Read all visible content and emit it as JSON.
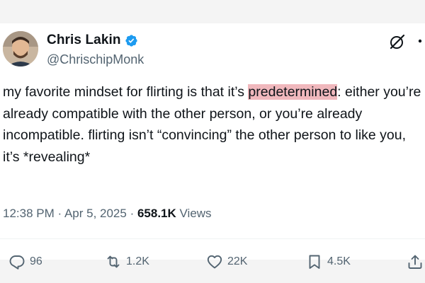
{
  "author": {
    "name": "Chris Lakin",
    "handle": "@ChrischipMonk"
  },
  "tweet": {
    "text_before": "my favorite mindset for flirting is that it’s ",
    "highlight": "predetermined",
    "text_after": ": either you’re already compatible with the other person, or you’re already incompatible. flirting isn’t “convincing” the other person to like you, it’s *revealing*"
  },
  "meta": {
    "time": "12:38 PM",
    "sep1": " · ",
    "date": "Apr 5, 2025",
    "sep2": " · ",
    "views_count": "658.1K",
    "views_label": " Views"
  },
  "stats": {
    "replies": "96",
    "reposts": "1.2K",
    "likes": "22K",
    "bookmarks": "4.5K"
  },
  "colors": {
    "highlight": "#f0b8bd",
    "verified": "#1d9bf0",
    "muted": "#536471",
    "text": "#0f1419"
  },
  "icons": [
    "verified-badge-icon",
    "grok-icon",
    "more-icon",
    "reply-icon",
    "repost-icon",
    "like-icon",
    "bookmark-icon",
    "share-icon"
  ]
}
